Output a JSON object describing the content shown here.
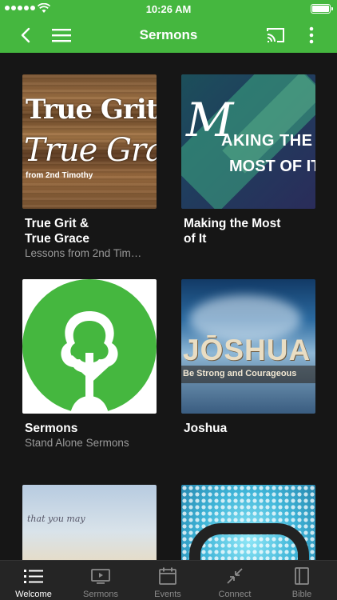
{
  "status_bar": {
    "time": "10:26 AM"
  },
  "nav": {
    "title": "Sermons"
  },
  "cards": [
    {
      "title": "True Grit & True Grace",
      "subtitle": "Lessons from 2nd Tim…",
      "art": {
        "line1": "True Grit &",
        "line2": "True Grace",
        "line3": "from 2nd Timothy"
      }
    },
    {
      "title": "Making the Most of It",
      "subtitle": "",
      "art": {
        "initial": "M",
        "line1": "AKING THE",
        "line2": "MOST OF IT"
      }
    },
    {
      "title": "Sermons",
      "subtitle": "Stand Alone Sermons",
      "art": {}
    },
    {
      "title": "Joshua",
      "subtitle": "",
      "art": {
        "line1": "JŌSHUA",
        "line2": "Be Strong and Courageous"
      }
    },
    {
      "title": "",
      "subtitle": "",
      "art": {
        "line1": "that you may"
      }
    },
    {
      "title": "",
      "subtitle": "",
      "art": {}
    }
  ],
  "tabs": [
    {
      "label": "Welcome",
      "icon": "list-icon",
      "active": true
    },
    {
      "label": "Sermons",
      "icon": "tv-icon",
      "active": false
    },
    {
      "label": "Events",
      "icon": "calendar-icon",
      "active": false
    },
    {
      "label": "Connect",
      "icon": "arrows-inward-icon",
      "active": false
    },
    {
      "label": "Bible",
      "icon": "book-icon",
      "active": false
    }
  ],
  "colors": {
    "brand": "#45b73f",
    "background": "#161616",
    "tabbar": "#252525"
  }
}
